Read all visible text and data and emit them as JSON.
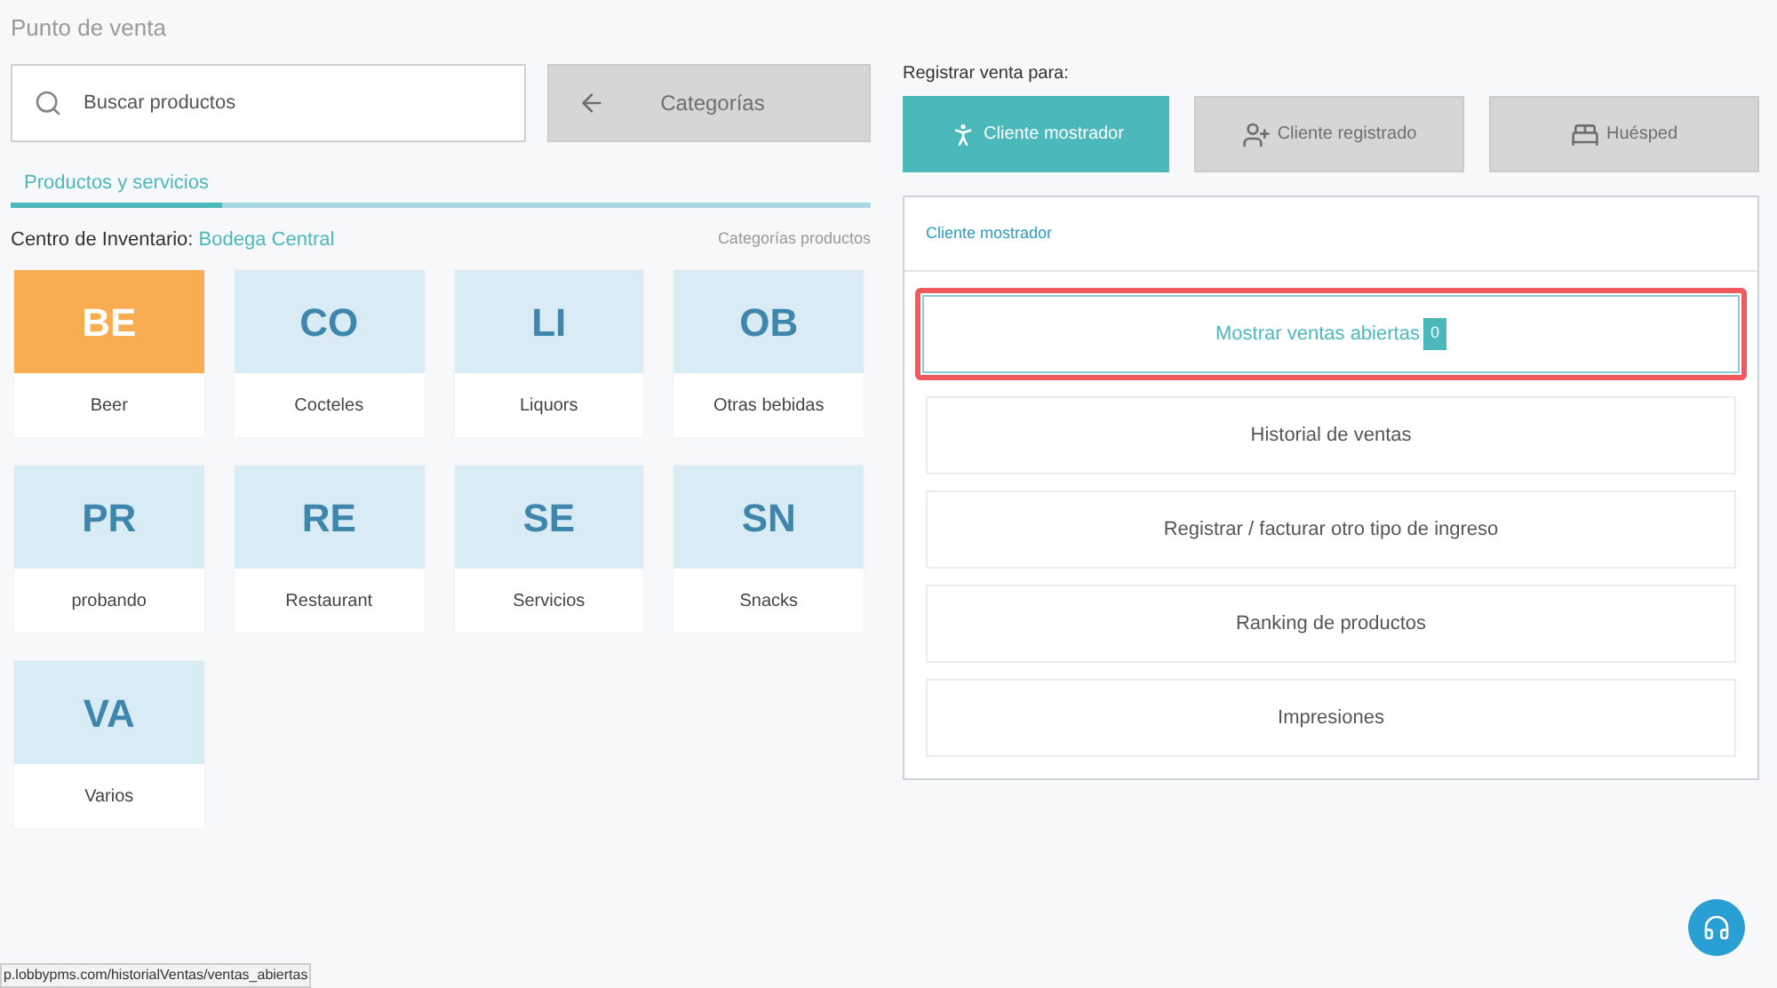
{
  "page_title": "Punto de venta",
  "search": {
    "placeholder": "Buscar productos"
  },
  "categories_button": {
    "label": "Categorías",
    "disabled": true
  },
  "tabs": [
    {
      "label": "Productos y servicios",
      "selected": true
    }
  ],
  "inventory": {
    "label": "Centro de Inventario:",
    "value": "Bodega Central",
    "link": "Categorías productos"
  },
  "categories": [
    {
      "abbr": "BE",
      "name": "Beer",
      "selected": true
    },
    {
      "abbr": "CO",
      "name": "Cocteles",
      "selected": false
    },
    {
      "abbr": "LI",
      "name": "Liquors",
      "selected": false
    },
    {
      "abbr": "OB",
      "name": "Otras bebidas",
      "selected": false
    },
    {
      "abbr": "PR",
      "name": "probando",
      "selected": false
    },
    {
      "abbr": "RE",
      "name": "Restaurant",
      "selected": false
    },
    {
      "abbr": "SE",
      "name": "Servicios",
      "selected": false
    },
    {
      "abbr": "SN",
      "name": "Snacks",
      "selected": false
    },
    {
      "abbr": "VA",
      "name": "Varios",
      "selected": false
    }
  ],
  "register_label": "Registrar venta para:",
  "customer_types": [
    {
      "kind": "walkin",
      "label": "Cliente mostrador",
      "selected": true
    },
    {
      "kind": "registered",
      "label": "Cliente registrado",
      "selected": false
    },
    {
      "kind": "guest",
      "label": "Huésped",
      "selected": false
    }
  ],
  "panel": {
    "title": "Cliente mostrador",
    "actions": [
      {
        "label": "Mostrar ventas abiertas",
        "badge": "0",
        "highlighted": true
      },
      {
        "label": "Historial de ventas",
        "highlighted": false
      },
      {
        "label": "Registrar / facturar otro tipo de ingreso",
        "highlighted": false
      },
      {
        "label": "Ranking de productos",
        "highlighted": false
      },
      {
        "label": "Impresiones",
        "highlighted": false
      }
    ]
  },
  "status_url": "p.lobbypms.com/historialVentas/ventas_abiertas"
}
